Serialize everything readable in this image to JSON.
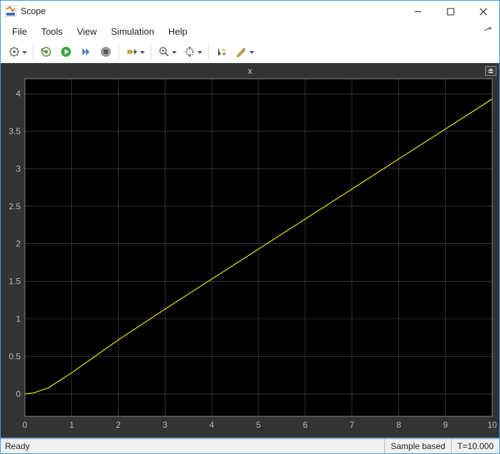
{
  "window": {
    "title": "Scope"
  },
  "menu": {
    "file": "File",
    "tools": "Tools",
    "view": "View",
    "simulation": "Simulation",
    "help": "Help"
  },
  "toolbar": {
    "gear": "settings-icon",
    "run_back": "restart-icon",
    "play": "play-icon",
    "step_fwd": "step-forward-icon",
    "stop": "stop-icon",
    "signals": "signal-selector-icon",
    "zoom": "zoom-icon",
    "axes": "axes-scale-icon",
    "cursor": "cursor-measure-icon",
    "highlight": "highlight-icon"
  },
  "status": {
    "ready": "Ready",
    "mode": "Sample based",
    "time": "T=10.000"
  },
  "chart_data": {
    "type": "line",
    "title": "x",
    "xlabel": "",
    "ylabel": "",
    "xlim": [
      0,
      10
    ],
    "ylim": [
      -0.3,
      4.2
    ],
    "xticks": [
      0,
      1,
      2,
      3,
      4,
      5,
      6,
      7,
      8,
      9,
      10
    ],
    "yticks": [
      0,
      0.5,
      1,
      1.5,
      2,
      2.5,
      3,
      3.5,
      4
    ],
    "x": [
      0,
      0.2,
      0.5,
      1,
      2,
      3,
      4,
      5,
      6,
      7,
      8,
      9,
      10
    ],
    "y": [
      0,
      0.015,
      0.08,
      0.28,
      0.72,
      1.13,
      1.53,
      1.93,
      2.33,
      2.73,
      3.13,
      3.53,
      3.93
    ],
    "line_color": "#e8e800",
    "grid": true
  }
}
